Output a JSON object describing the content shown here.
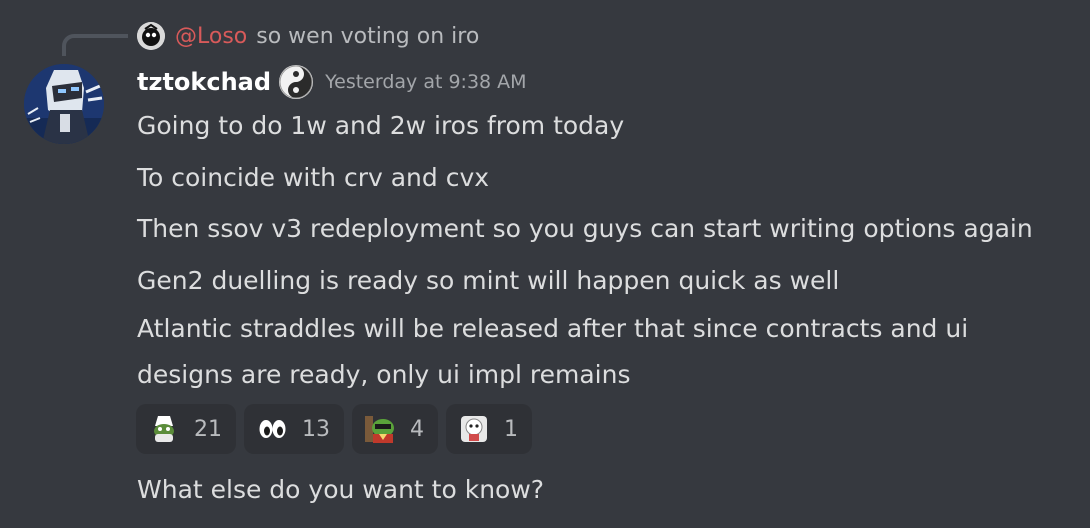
{
  "reply": {
    "mention": "@Loso",
    "text": "so wen voting on iro"
  },
  "author": {
    "username": "tztokchad",
    "timestamp": "Yesterday at 9:38 AM",
    "avatar_icon": "pixel-art-character-avatar",
    "badge_icon": "yin-yang-badge-icon"
  },
  "messages": [
    {
      "text": "Going to do 1w and 2w iros from today"
    },
    {
      "text": "To coincide with crv and cvx"
    },
    {
      "text": "Then ssov v3 redeployment so you guys can start writing options again"
    },
    {
      "text": "Gen2 duelling is ready so mint will happen quick as well"
    },
    {
      "text": "Atlantic straddles will be released after that since contracts and ui designs are ready, only ui impl remains"
    },
    {
      "text": "What else do you want to know?"
    }
  ],
  "reactions": [
    {
      "icon": "pepe-wizard-emoji",
      "count": "21"
    },
    {
      "icon": "eyes-emoji",
      "count": "13"
    },
    {
      "icon": "pepe-hacker-emoji",
      "count": "4"
    },
    {
      "icon": "sticker-character-emoji",
      "count": "1"
    }
  ],
  "colors": {
    "background": "#36393f",
    "mention": "#d85a5a",
    "message_text": "#dcddde",
    "timestamp": "#a3a6aa",
    "reaction_bg": "#2f3136"
  }
}
